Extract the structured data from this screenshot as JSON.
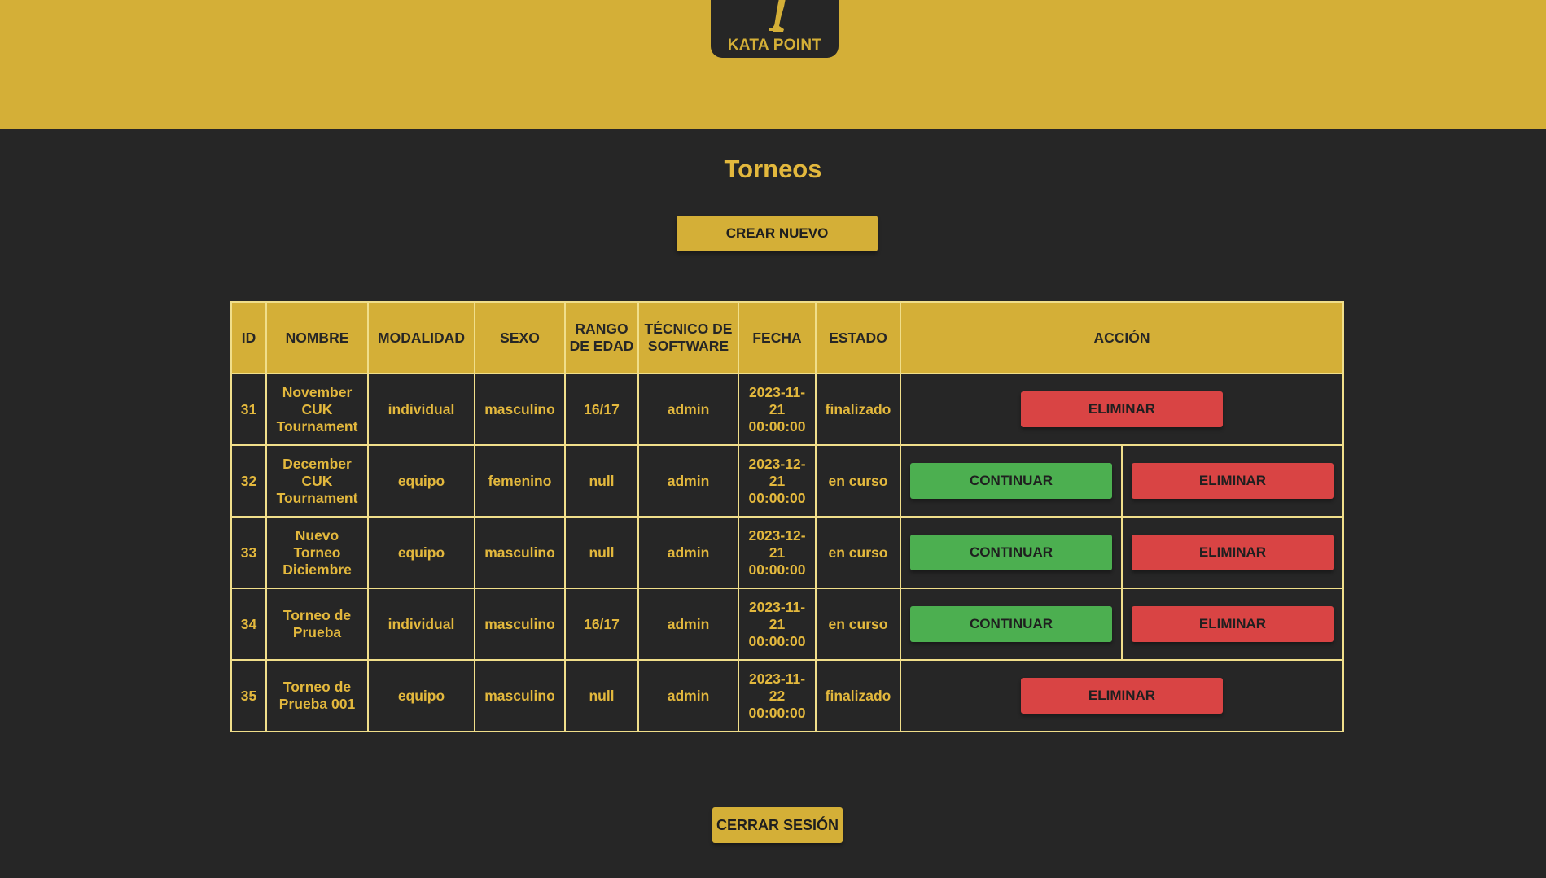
{
  "brand": {
    "logo_text": "KATA POINT"
  },
  "page": {
    "title": "Torneos"
  },
  "actions": {
    "create_label": "CREAR NUEVO",
    "logout_label": "CERRAR SESIÓN"
  },
  "colors": {
    "accent_gold": "#d4af37",
    "background": "#262626",
    "continue_green": "#4caf50",
    "delete_red": "#d94444"
  },
  "table": {
    "headers": {
      "id": "ID",
      "nombre": "NOMBRE",
      "modalidad": "MODALIDAD",
      "sexo": "SEXO",
      "rango": "RANGO DE EDAD",
      "tecnico": "TÉCNICO DE SOFTWARE",
      "fecha": "FECHA",
      "estado": "ESTADO",
      "accion": "ACCIÓN"
    },
    "rows": [
      {
        "id": "31",
        "nombre": "November CUK Tournament",
        "modalidad": "individual",
        "sexo": "masculino",
        "rango": "16/17",
        "tecnico": "admin",
        "fecha": "2023-11-21 00:00:00",
        "estado": "finalizado",
        "eliminar": "ELIMINAR"
      },
      {
        "id": "32",
        "nombre": "December CUK Tournament",
        "modalidad": "equipo",
        "sexo": "femenino",
        "rango": "null",
        "tecnico": "admin",
        "fecha": "2023-12-21 00:00:00",
        "estado": "en curso",
        "continuar": "CONTINUAR",
        "eliminar": "ELIMINAR"
      },
      {
        "id": "33",
        "nombre": "Nuevo Torneo Diciembre",
        "modalidad": "equipo",
        "sexo": "masculino",
        "rango": "null",
        "tecnico": "admin",
        "fecha": "2023-12-21 00:00:00",
        "estado": "en curso",
        "continuar": "CONTINUAR",
        "eliminar": "ELIMINAR"
      },
      {
        "id": "34",
        "nombre": "Torneo de Prueba",
        "modalidad": "individual",
        "sexo": "masculino",
        "rango": "16/17",
        "tecnico": "admin",
        "fecha": "2023-11-21 00:00:00",
        "estado": "en curso",
        "continuar": "CONTINUAR",
        "eliminar": "ELIMINAR"
      },
      {
        "id": "35",
        "nombre": "Torneo de Prueba 001",
        "modalidad": "equipo",
        "sexo": "masculino",
        "rango": "null",
        "tecnico": "admin",
        "fecha": "2023-11-22 00:00:00",
        "estado": "finalizado",
        "eliminar": "ELIMINAR"
      }
    ]
  }
}
